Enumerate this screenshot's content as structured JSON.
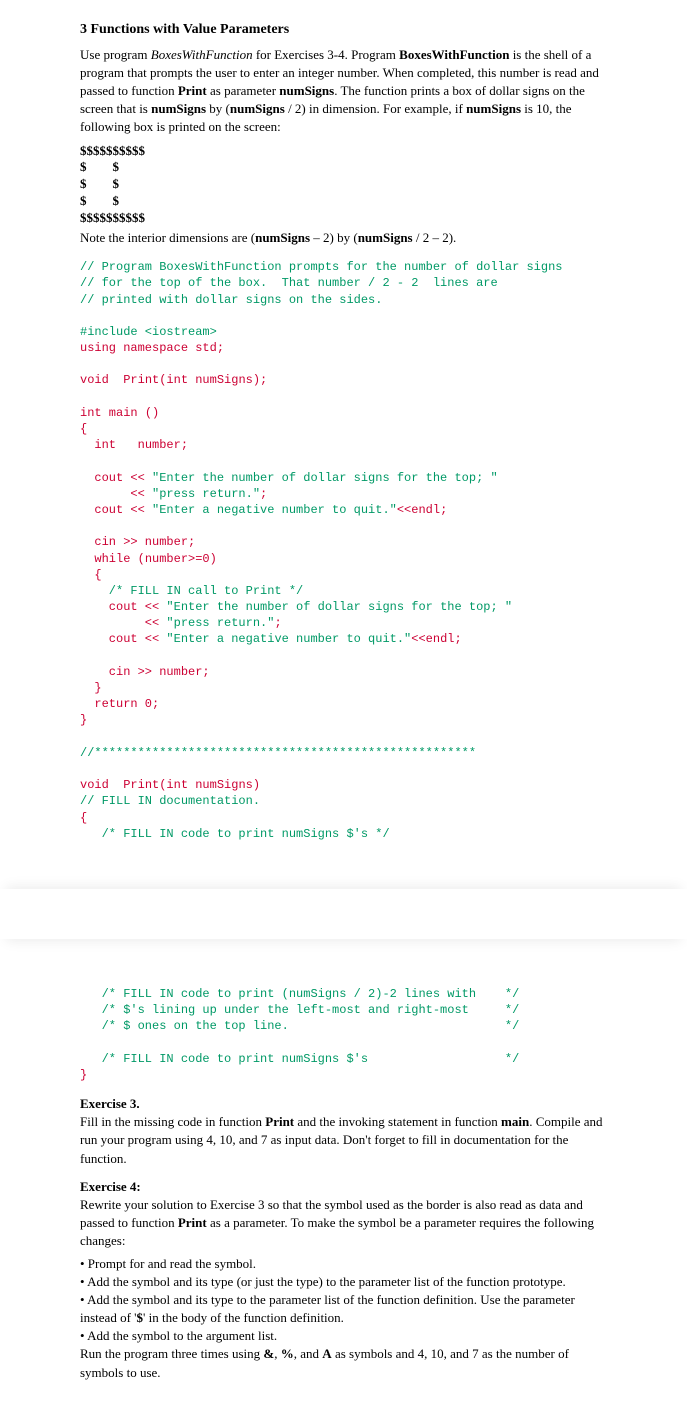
{
  "section_heading": "3   Functions with Value Parameters",
  "intro_para_html": "Use program <span class='italic'>BoxesWithFunction</span> for Exercises 3-4.  Program <span class='bold'>BoxesWithFunction</span> is the shell of a program that prompts the user to enter an integer number. When completed, this number is read and passed to function <span class='bold'>Print</span> as parameter <span class='bold'>numSigns</span>. The function prints a box of dollar signs on the screen that is <span class='bold'>numSigns</span> by (<span class='bold'>numSigns</span> / 2) in dimension. For example, if <span class='bold'>numSigns</span> is 10, the following box is printed on the screen:",
  "dollar_box": "$$$$$$$$$$\n$        $\n$        $\n$        $\n$$$$$$$$$$",
  "note_html": "Note the interior dimensions are (<span class='bold'>numSigns</span> – 2)  by (<span class='bold'>numSigns</span> / 2 – 2).",
  "code_top": {
    "c1": "// Program BoxesWithFunction prompts for the number of dollar signs",
    "c2": "// for the top of the box.  That number / 2 - 2  lines are",
    "c3": "// printed with dollar signs on the sides.",
    "inc": "#include <iostream>",
    "using": "using namespace std;",
    "proto_void": "void",
    "proto_print": "  Print(",
    "proto_int": "int",
    "proto_rest": " numSigns);",
    "main_int": "int",
    "main_decl": " main ()",
    "open": "{",
    "var_int": "  int",
    "var_rest": "   number;",
    "cout1_c": "  cout <<",
    "cout1_s": " \"Enter the number of dollar signs for the top; \"",
    "cout2_c": "       <<",
    "cout2_s": " \"press return.\"",
    "cout2_end": ";",
    "cout3_c": "  cout <<",
    "cout3_s": " \"Enter a negative number to quit.\"",
    "cout3_end": "<<endl;",
    "cin1": "  cin >> number;",
    "while_kw": "  while",
    "while_cond": " (number>=0)",
    "open2": "  {",
    "fill1": "    /* FILL IN call to Print */",
    "cout4_c": "    cout <<",
    "cout4_s": " \"Enter the number of dollar signs for the top; \"",
    "cout5_c": "         <<",
    "cout5_s": " \"press return.\"",
    "cout5_end": ";",
    "cout6_c": "    cout <<",
    "cout6_s": " \"Enter a negative number to quit.\"",
    "cout6_end": "<<endl;",
    "cin2": "    cin >> number;",
    "close2": "  }",
    "ret_kw": "  return",
    "ret_val": " 0;",
    "close1": "}",
    "stars": "//*****************************************************",
    "pv_void": "void",
    "pv_print": "  Print(",
    "pv_int": "int",
    "pv_rest": " numSigns)",
    "fill2": "// FILL IN documentation.",
    "open3": "{",
    "fill3": "   /* FILL IN code to print numSigns $'s */"
  },
  "code_bottom": {
    "l1": "   /* FILL IN code to print (numSigns / 2)-2 lines with    */",
    "l2": "   /* $'s lining up under the left-most and right-most     */",
    "l3": "   /* $ ones on the top line.                              */",
    "l4": "   /* FILL IN code to print numSigns $'s                   */",
    "close": "}"
  },
  "exercise3": {
    "title": "Exercise 3.",
    "body_html": "Fill in the missing code in function <span class='bold'>Print</span> and the invoking statement in function <span class='bold'>main</span>. Compile and run your program using 4, 10, and 7 as input data. Don't forget to fill in documentation for the function."
  },
  "exercise4": {
    "title": "Exercise 4:",
    "intro_html": "Rewrite your solution to Exercise 3 so that the symbol used as the border is also read as data and passed to function <span class='bold'>Print</span> as a parameter. To make the symbol be a parameter requires the following changes:",
    "b1": "• Prompt for and read the symbol.",
    "b2": "• Add the symbol and its type (or just the type) to the parameter list of the function prototype.",
    "b3_html": "• Add the symbol and its type to the parameter list of the function definition. Use the parameter instead of '<span class='bold'>$</span>' in the body of the function definition.",
    "b4": "• Add the symbol to the argument list.",
    "run_html": "Run the program three times using <span class='bold'>&amp;</span>, <span class='bold'>%</span>, and <span class='bold'>A</span> as symbols and 4, 10, and 7 as the number of symbols to use."
  }
}
